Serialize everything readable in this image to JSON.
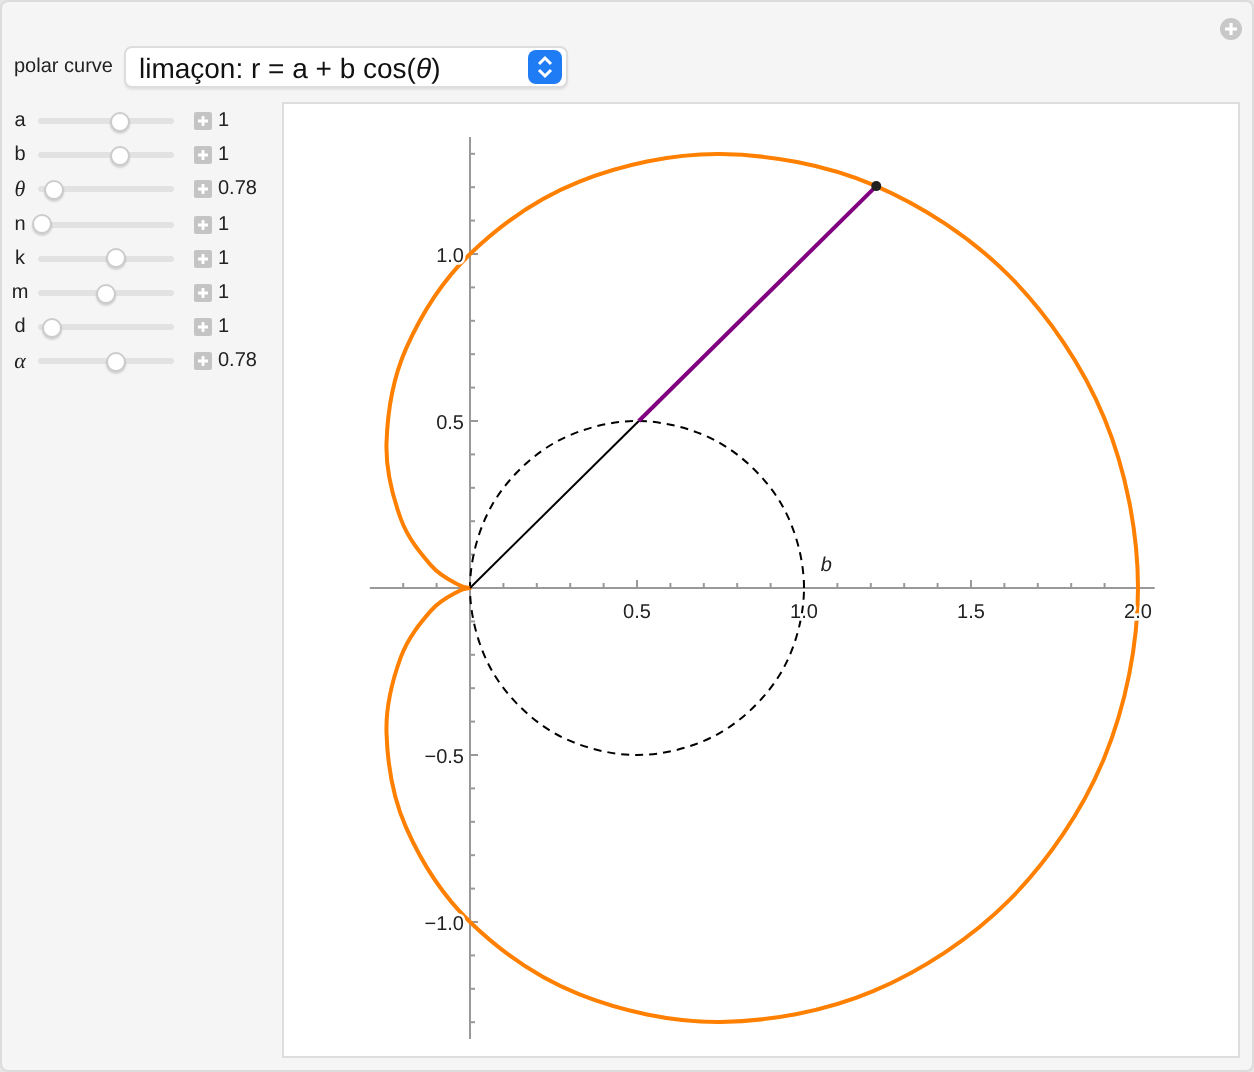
{
  "control": {
    "label": "polar curve",
    "dropdown": "limaçon: r = a + b cos(*θ*)"
  },
  "sliders": [
    {
      "name": "a",
      "italic": false,
      "level": 0.6,
      "reading": "1"
    },
    {
      "name": "b",
      "italic": false,
      "level": 0.6,
      "reading": "1"
    },
    {
      "name": "θ",
      "italic": true,
      "level": 0.12,
      "reading": "0.78"
    },
    {
      "name": "n",
      "italic": false,
      "level": 0.03,
      "reading": "1"
    },
    {
      "name": "k",
      "italic": false,
      "level": 0.57,
      "reading": "1"
    },
    {
      "name": "m",
      "italic": false,
      "level": 0.5,
      "reading": "1"
    },
    {
      "name": "d",
      "italic": false,
      "level": 0.1,
      "reading": "1"
    },
    {
      "name": "α",
      "italic": true,
      "level": 0.57,
      "reading": "0.78"
    }
  ],
  "plot": {
    "x_axis_labels": [
      "0.5",
      "1.0",
      "1.5",
      "2.0"
    ],
    "y_axis_labels": [
      "1.0",
      "0.5",
      "−0.5",
      "−1.0"
    ],
    "circle_label": "b"
  }
}
